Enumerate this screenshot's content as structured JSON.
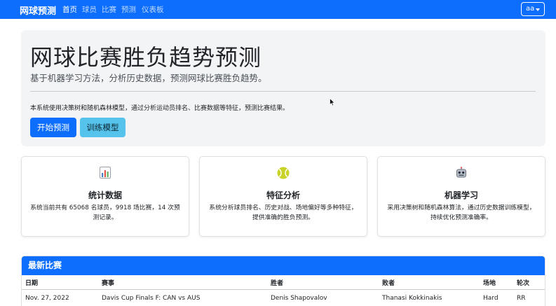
{
  "navbar": {
    "brand": "网球预测",
    "links": [
      "首页",
      "球员",
      "比赛",
      "预测",
      "仪表板"
    ],
    "user": "aa"
  },
  "hero": {
    "title": "网球比赛胜负趋势预测",
    "lead": "基于机器学习方法，分析历史数据，预测网球比赛胜负趋势。",
    "description": "本系统使用决策树和随机森林模型，通过分析运动员排名、比赛数据等特征，预测比赛结果。",
    "primary_button": "开始预测",
    "secondary_button": "训练模型"
  },
  "cards": [
    {
      "icon": "bar-chart-icon",
      "title": "统计数据",
      "text": "系统当前共有 65068 名球员，9918 场比赛，14 次预测记录。"
    },
    {
      "icon": "tennis-ball-icon",
      "title": "特征分析",
      "text": "系统分析球员排名、历史对战、场地偏好等多种特征，提供准确的胜负预测。"
    },
    {
      "icon": "robot-icon",
      "title": "机器学习",
      "text": "采用决策树和随机森林算法，通过历史数据训练模型，持续优化预测准确率。"
    }
  ],
  "matches": {
    "header": "最新比赛",
    "columns": [
      "日期",
      "赛事",
      "胜者",
      "败者",
      "场地",
      "轮次"
    ],
    "rows": [
      [
        "Nov. 27, 2022",
        "Davis Cup Finals F: CAN vs AUS",
        "Denis Shapovalov",
        "Thanasi Kokkinakis",
        "Hard",
        "RR"
      ]
    ]
  }
}
